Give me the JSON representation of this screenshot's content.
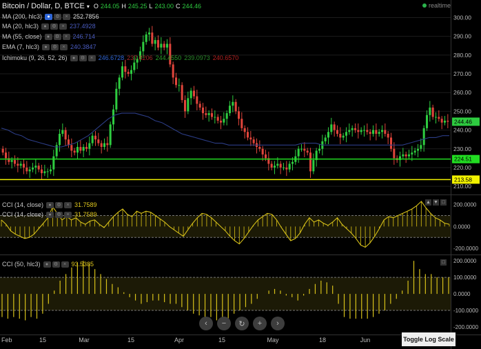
{
  "header": {
    "symbol": "Bitcoin / Dollar, D, BTCE",
    "open_label": "O",
    "open": "244.05",
    "high_label": "H",
    "high": "245.25",
    "low_label": "L",
    "low": "243.00",
    "close_label": "C",
    "close": "244.46",
    "realtime": "realtime"
  },
  "indicators": [
    {
      "name": "MA (200, hlc3)",
      "value": "252.7856",
      "color": "#dddddd"
    },
    {
      "name": "MA (20, hlc3)",
      "value": "237.4928",
      "color": "#3d4ea0"
    },
    {
      "name": "MA (55, close)",
      "value": "246.714",
      "color": "#3d4ea0"
    },
    {
      "name": "EMA (7, hlc3)",
      "value": "240.3847",
      "color": "#3d4ea0"
    },
    {
      "name": "Ichimoku (9, 26, 52, 26)",
      "values": [
        "246.6728",
        "237.8206",
        "244.4550",
        "239.0973",
        "240.6570"
      ],
      "colors": [
        "#2f66d6",
        "#a52a2a",
        "#2aa02a",
        "#2a8a2a",
        "#b81f1f"
      ]
    }
  ],
  "cci_panels": [
    {
      "label": "CCI (14, close)",
      "value": "31.7589"
    },
    {
      "label": "CCI (14, close)",
      "value": "31.7589"
    },
    {
      "label": "CCI (50, hlc3)",
      "value": "93.5385"
    }
  ],
  "price_axis": {
    "ticks": [
      "300.00",
      "290.00",
      "280.00",
      "270.00",
      "260.00",
      "250.00",
      "240.00",
      "230.00",
      "220.00",
      "210.00"
    ],
    "ylim": [
      206,
      302
    ],
    "last_price": "244.46",
    "green_line": "224.51",
    "yellow_line": "213.58"
  },
  "cci_axis": {
    "ticks": [
      "200.0000",
      "0.0000",
      "-200.0000"
    ],
    "ylim": [
      -250,
      280
    ]
  },
  "cci50_axis": {
    "ticks": [
      "200.0000",
      "100.0000",
      "0.0000",
      "-100.0000",
      "-200.0000"
    ],
    "ylim": [
      -225,
      230
    ]
  },
  "x_axis": {
    "labels": [
      "Feb",
      "15",
      "Mar",
      "15",
      "Apr",
      "15",
      "May",
      "18",
      "Jun"
    ]
  },
  "toggle_log_scale": "Toggle Log Scale",
  "colors": {
    "up": "#2ecc40",
    "down": "#e0453b",
    "grid": "#1c1c1c",
    "cci_line": "#d8c21a",
    "band_fill": "#1c1a06",
    "green_line": "#22dd22",
    "yellow_line": "#f2f200"
  },
  "chart_data": {
    "type": "candlestick",
    "closes": [
      228,
      225,
      223,
      224,
      222,
      221,
      222,
      220,
      218,
      219,
      220,
      221,
      219,
      217,
      218,
      218,
      219,
      226,
      232,
      238,
      240,
      235,
      232,
      229,
      228,
      231,
      229,
      231,
      230,
      233,
      237,
      235,
      233,
      231,
      233,
      232,
      243,
      251,
      262,
      268,
      274,
      271,
      270,
      272,
      276,
      278,
      282,
      287,
      291,
      292,
      286,
      288,
      284,
      286,
      284,
      286,
      275,
      268,
      264,
      264,
      256,
      250,
      257,
      261,
      258,
      254,
      252,
      249,
      248,
      249,
      247,
      247,
      245,
      244,
      246,
      249,
      253,
      255,
      250,
      246,
      241,
      239,
      236,
      235,
      233,
      231,
      230,
      227,
      225,
      222,
      220,
      221,
      222,
      220,
      220,
      219,
      222,
      223,
      226,
      230,
      230,
      229,
      228,
      218,
      224,
      229,
      230,
      234,
      236,
      239,
      243,
      240,
      238,
      236,
      237,
      239,
      240,
      241,
      240,
      239,
      240,
      240,
      239,
      238,
      240,
      238,
      239,
      240,
      238,
      236,
      230,
      225,
      224,
      226,
      227,
      226,
      227,
      228,
      229,
      230,
      232,
      241,
      248,
      252,
      247,
      247,
      246,
      244,
      245,
      244.46
    ],
    "ma_long": [
      241,
      240,
      238,
      237,
      235,
      234,
      233,
      232,
      231,
      231,
      232,
      233,
      235,
      237,
      240,
      243,
      246,
      248,
      249,
      249,
      249,
      248,
      247,
      245,
      244,
      242,
      240,
      238,
      237,
      236,
      235,
      234,
      233,
      233,
      232,
      232,
      232,
      232,
      232,
      232,
      232,
      232,
      232,
      232,
      232,
      233,
      233,
      233,
      232,
      232,
      232,
      232,
      232,
      232,
      232,
      232,
      232,
      232,
      232,
      232,
      232,
      233,
      234,
      235,
      236,
      236,
      237,
      237
    ],
    "cci14": [
      60,
      20,
      -40,
      -70,
      -90,
      -110,
      -100,
      -70,
      -20,
      30,
      80,
      180,
      120,
      60,
      90,
      60,
      80,
      40,
      20,
      50,
      60,
      20,
      -10,
      40,
      90,
      130,
      160,
      110,
      90,
      140,
      120,
      140,
      130,
      100,
      70,
      40,
      0,
      -30,
      -60,
      -90,
      -30,
      30,
      80,
      120,
      110,
      80,
      40,
      0,
      -40,
      -90,
      -130,
      -160,
      -110,
      -50,
      10,
      60,
      90,
      120,
      110,
      60,
      -10,
      -70,
      -130,
      -110,
      -60,
      20,
      80,
      40,
      60,
      30,
      10,
      40,
      80,
      20,
      -20,
      -60,
      -110,
      -170,
      -190,
      -150,
      -90,
      -20,
      60,
      90,
      80,
      100,
      120,
      140,
      160,
      190,
      230,
      170,
      120,
      80,
      60,
      30,
      20
    ],
    "cci50": [
      -140,
      -150,
      -140,
      -150,
      -160,
      -140,
      -150,
      -120,
      -60,
      20,
      80,
      120,
      160,
      190,
      200,
      180,
      150,
      120,
      90,
      60,
      40,
      10,
      -20,
      -40,
      -60,
      -50,
      -40,
      -40,
      -50,
      -60,
      -60,
      -80,
      -100,
      -120,
      -130,
      -150,
      -140,
      -160,
      -170,
      -150,
      -120,
      -100,
      -80,
      -60,
      -30,
      0,
      20,
      30,
      20,
      -10,
      -20,
      -40,
      -10,
      30,
      60,
      80,
      70,
      50,
      -60,
      -140,
      -150,
      -150,
      -150,
      -150,
      -140,
      -120,
      -100,
      -60,
      -30,
      20,
      80,
      200,
      150,
      120,
      120,
      100,
      100,
      100
    ]
  }
}
